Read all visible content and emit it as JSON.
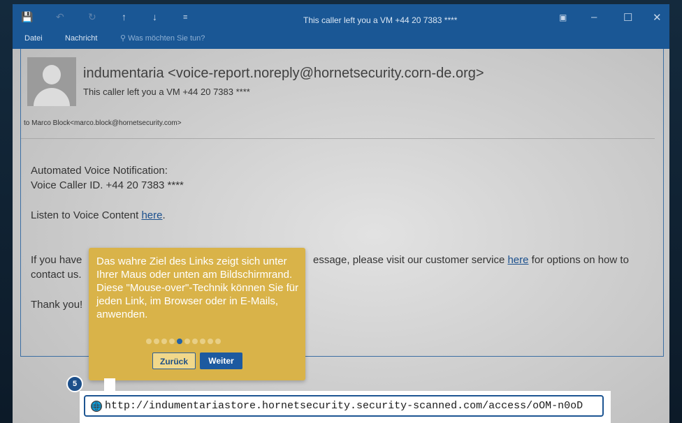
{
  "window": {
    "title": "This caller left you a VM +44 20 7383 ****",
    "ribbon_tabs": [
      "Datei",
      "Nachricht"
    ],
    "tell_me_placeholder": "Was möchten Sie tun?"
  },
  "email": {
    "sender": "indumentaria <voice-report.noreply@hornetsecurity.corn-de.org>",
    "subject": "This caller left you a VM +44 20 7383 ****",
    "to": "to Marco Block<marco.block@hornetsecurity.com>",
    "body": {
      "line1": "Automated Voice Notification:",
      "line2": "Voice Caller ID. +44 20 7383 ****",
      "listen_prefix": "Listen to Voice Content ",
      "listen_link": "here",
      "listen_suffix": ".",
      "info_prefix": "If you have",
      "info_middle": "essage, please visit our customer service ",
      "info_link": "here",
      "info_suffix": " for options on how to",
      "info_line2": "contact us.",
      "thanks": "Thank you!"
    }
  },
  "tutorial": {
    "text": "Das wahre Ziel des Links zeigt sich unter Ihrer Maus oder unten am Bildschirmrand. Diese \"Mouse-over\"-Technik können Sie für jeden Link, im Browser oder in E-Mails, anwenden.",
    "back_label": "Zurück",
    "next_label": "Weiter",
    "step_number": "5",
    "steps_total": 10,
    "active_step": 4
  },
  "status_url": "http://indumentariastore.hornetsecurity.security-scanned.com/access/oOM-n0oD",
  "colors": {
    "titlebar": "#1a5795",
    "tooltip": "#d9b349",
    "accent": "#1d5aa0"
  }
}
